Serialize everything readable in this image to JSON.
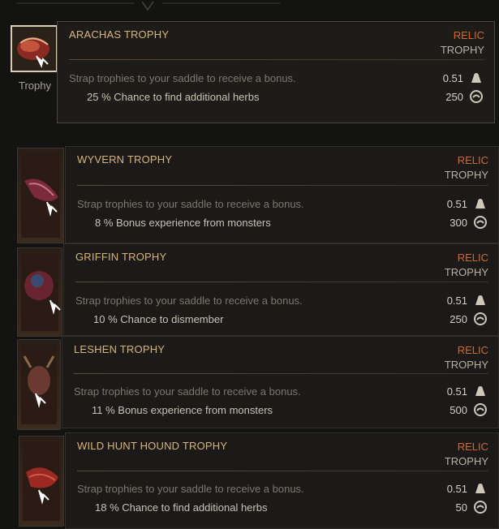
{
  "selected_slot": {
    "label": "Trophy"
  },
  "stat_labels": {
    "weight_icon": "weight-icon",
    "value_icon": "crowns-icon"
  },
  "colors": {
    "title": "#d8b47a",
    "rarity": "#d06a2c",
    "type": "#b8b1a4",
    "desc": "#7d776c",
    "text": "#c9c2b4"
  },
  "items": [
    {
      "title": "ARACHAS TROPHY",
      "rarity": "RELIC",
      "type": "TROPHY",
      "description": "Strap trophies to your saddle to receive a bonus.",
      "bonus": "25 %  Chance to find additional herbs",
      "weight": "0.51",
      "value": "250"
    },
    {
      "title": "WYVERN TROPHY",
      "rarity": "RELIC",
      "type": "TROPHY",
      "description": "Strap trophies to your saddle to receive a bonus.",
      "bonus": "8 %  Bonus experience from monsters",
      "weight": "0.51",
      "value": "300"
    },
    {
      "title": "GRIFFIN TROPHY",
      "rarity": "RELIC",
      "type": "TROPHY",
      "description": "Strap trophies to your saddle to receive a bonus.",
      "bonus": "10 %  Chance to dismember",
      "weight": "0.51",
      "value": "250"
    },
    {
      "title": "LESHEN TROPHY",
      "rarity": "RELIC",
      "type": "TROPHY",
      "description": "Strap trophies to your saddle to receive a bonus.",
      "bonus": "11 %  Bonus experience from monsters",
      "weight": "0.51",
      "value": "500"
    },
    {
      "title": "WILD HUNT HOUND TROPHY",
      "rarity": "RELIC",
      "type": "TROPHY",
      "description": "Strap trophies to your saddle to receive a bonus.",
      "bonus": "18 %  Chance to find additional herbs",
      "weight": "0.51",
      "value": "50"
    }
  ]
}
